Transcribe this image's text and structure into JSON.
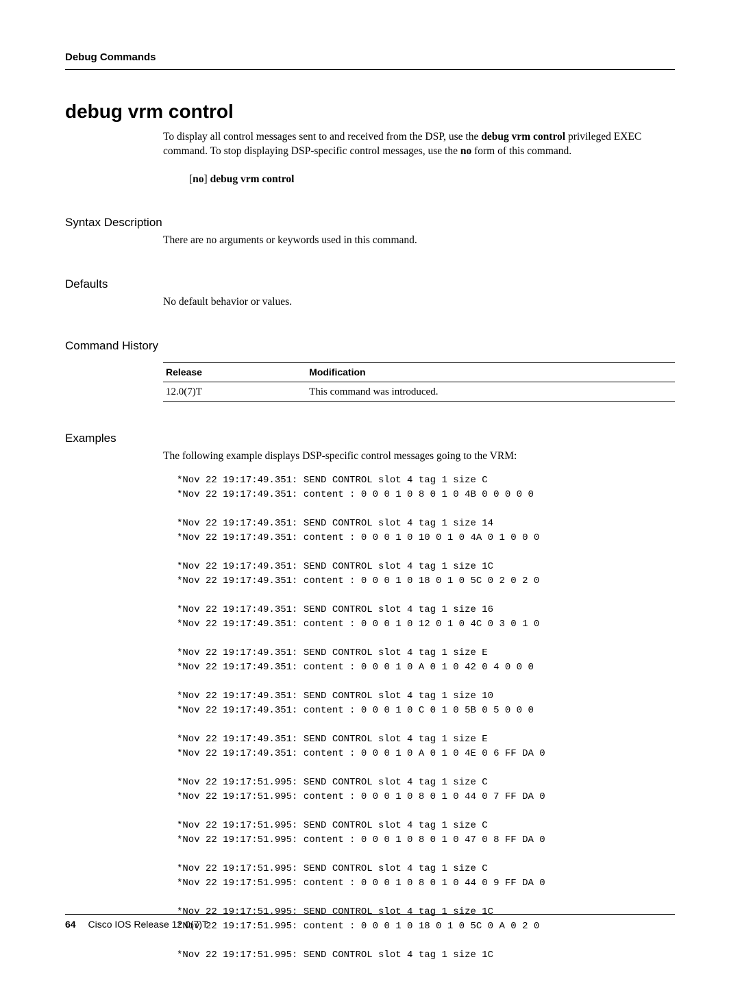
{
  "header": {
    "chapter": "Debug Commands"
  },
  "title": "debug vrm control",
  "intro": {
    "prefix": "To display all control messages sent to and received from the DSP, use the ",
    "cmd1": "debug vrm control",
    "mid": " privileged EXEC command. To stop displaying DSP-specific control messages, use the ",
    "no_word": "no",
    "suffix": " form of this command."
  },
  "syntax_form": {
    "no": "no",
    "rest": " debug vrm control"
  },
  "sections": {
    "syntax_label": "Syntax Description",
    "syntax_body": "There are no arguments or keywords used in this command.",
    "defaults_label": "Defaults",
    "defaults_body": "No default behavior or values.",
    "history_label": "Command History",
    "examples_label": "Examples",
    "examples_intro": "The following example displays DSP-specific control messages going to the VRM:"
  },
  "history_table": {
    "col1": "Release",
    "col2": "Modification",
    "row1_release": "12.0(7)T",
    "row1_mod": "This command was introduced."
  },
  "example_output": "*Nov 22 19:17:49.351: SEND CONTROL slot 4 tag 1 size C\n*Nov 22 19:17:49.351: content : 0 0 0 1 0 8 0 1 0 4B 0 0 0 0 0\n\n*Nov 22 19:17:49.351: SEND CONTROL slot 4 tag 1 size 14\n*Nov 22 19:17:49.351: content : 0 0 0 1 0 10 0 1 0 4A 0 1 0 0 0\n\n*Nov 22 19:17:49.351: SEND CONTROL slot 4 tag 1 size 1C\n*Nov 22 19:17:49.351: content : 0 0 0 1 0 18 0 1 0 5C 0 2 0 2 0\n\n*Nov 22 19:17:49.351: SEND CONTROL slot 4 tag 1 size 16\n*Nov 22 19:17:49.351: content : 0 0 0 1 0 12 0 1 0 4C 0 3 0 1 0\n\n*Nov 22 19:17:49.351: SEND CONTROL slot 4 tag 1 size E\n*Nov 22 19:17:49.351: content : 0 0 0 1 0 A 0 1 0 42 0 4 0 0 0\n\n*Nov 22 19:17:49.351: SEND CONTROL slot 4 tag 1 size 10\n*Nov 22 19:17:49.351: content : 0 0 0 1 0 C 0 1 0 5B 0 5 0 0 0\n\n*Nov 22 19:17:49.351: SEND CONTROL slot 4 tag 1 size E\n*Nov 22 19:17:49.351: content : 0 0 0 1 0 A 0 1 0 4E 0 6 FF DA 0\n\n*Nov 22 19:17:51.995: SEND CONTROL slot 4 tag 1 size C\n*Nov 22 19:17:51.995: content : 0 0 0 1 0 8 0 1 0 44 0 7 FF DA 0\n\n*Nov 22 19:17:51.995: SEND CONTROL slot 4 tag 1 size C\n*Nov 22 19:17:51.995: content : 0 0 0 1 0 8 0 1 0 47 0 8 FF DA 0\n\n*Nov 22 19:17:51.995: SEND CONTROL slot 4 tag 1 size C\n*Nov 22 19:17:51.995: content : 0 0 0 1 0 8 0 1 0 44 0 9 FF DA 0\n\n*Nov 22 19:17:51.995: SEND CONTROL slot 4 tag 1 size 1C\n*Nov 22 19:17:51.995: content : 0 0 0 1 0 18 0 1 0 5C 0 A 0 2 0\n\n*Nov 22 19:17:51.995: SEND CONTROL slot 4 tag 1 size 1C",
  "footer": {
    "page": "64",
    "release_line": "Cisco IOS Release 12.0(7)T"
  }
}
